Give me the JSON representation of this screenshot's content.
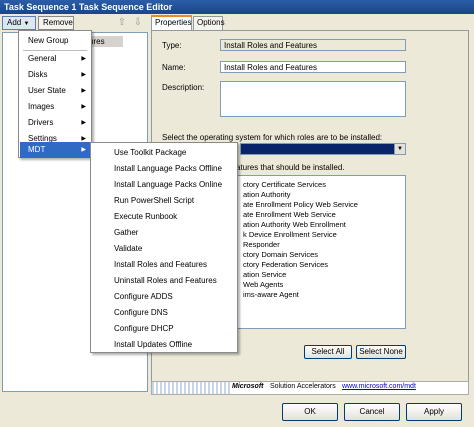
{
  "window": {
    "title": "Task Sequence 1 Task Sequence Editor"
  },
  "toolbar": {
    "add_label": "Add",
    "remove_label": "Remove"
  },
  "tree": {
    "selected_label": "ures"
  },
  "tabs": [
    {
      "label": "Properties"
    },
    {
      "label": "Options"
    }
  ],
  "properties": {
    "type_label": "Type:",
    "type_value": "Install Roles and Features",
    "name_label": "Name:",
    "name_value": "Install Roles and Features",
    "description_label": "Description:",
    "os_prompt": "Select the operating system for which roles are to be installed:",
    "features_prompt": "atures that should be installed.",
    "features": [
      "ctory Certificate Services",
      "ation Authority",
      "ate Enrollment Policy Web Service",
      "ate Enrollment Web Service",
      "ation Authority Web Enrollment",
      "k Device Enrollment Service",
      "Responder",
      "ctory Domain Services",
      "ctory Federation Services",
      "ation Service",
      "Web Agents",
      "ims-aware Agent"
    ],
    "select_all_label": "Select All",
    "select_none_label": "Select None"
  },
  "banner": {
    "logo": "Microsoft",
    "tagline": "Solution Accelerators",
    "link": "www.microsoft.com/mdt"
  },
  "buttons": {
    "ok": "OK",
    "cancel": "Cancel",
    "apply": "Apply"
  },
  "add_menu": {
    "items": [
      {
        "label": "New Group"
      },
      {
        "label": "General"
      },
      {
        "label": "Disks"
      },
      {
        "label": "User State"
      },
      {
        "label": "Images"
      },
      {
        "label": "Drivers"
      },
      {
        "label": "Settings"
      },
      {
        "label": "MDT"
      }
    ]
  },
  "mdt_menu": {
    "items": [
      {
        "label": "Use Toolkit Package"
      },
      {
        "label": "Install Language Packs Offline"
      },
      {
        "label": "Install Language Packs Online"
      },
      {
        "label": "Run PowerShell Script"
      },
      {
        "label": "Execute Runbook"
      },
      {
        "label": "Gather"
      },
      {
        "label": "Validate"
      },
      {
        "label": "Install Roles and Features"
      },
      {
        "label": "Uninstall Roles and Features"
      },
      {
        "label": "Configure ADDS"
      },
      {
        "label": "Configure DNS"
      },
      {
        "label": "Configure DHCP"
      },
      {
        "label": "Install Updates Offline"
      }
    ]
  },
  "colors": {
    "highlight": "#316ac5",
    "title_bar": "#2b5ea8",
    "os_selection": "#0a246a"
  }
}
